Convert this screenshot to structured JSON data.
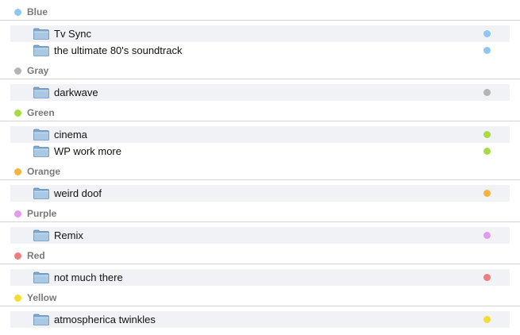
{
  "groups": [
    {
      "label": "Blue",
      "color": "#8ec8f2",
      "items": [
        {
          "label": "Tv Sync",
          "icon": "folder-icon"
        },
        {
          "label": "the ultimate 80's soundtrack",
          "icon": "folder-icon"
        }
      ]
    },
    {
      "label": "Gray",
      "color": "#b4b4b4",
      "items": [
        {
          "label": "darkwave",
          "icon": "folder-icon"
        }
      ]
    },
    {
      "label": "Green",
      "color": "#a6dc3c",
      "items": [
        {
          "label": "cinema",
          "icon": "folder-icon"
        },
        {
          "label": "WP work more",
          "icon": "folder-icon"
        }
      ]
    },
    {
      "label": "Orange",
      "color": "#f6b33c",
      "items": [
        {
          "label": "weird doof",
          "icon": "folder-icon"
        }
      ]
    },
    {
      "label": "Purple",
      "color": "#e39aee",
      "items": [
        {
          "label": "Remix",
          "icon": "folder-icon"
        }
      ]
    },
    {
      "label": "Red",
      "color": "#ef7d7d",
      "items": [
        {
          "label": "not much there",
          "icon": "folder-icon"
        }
      ]
    },
    {
      "label": "Yellow",
      "color": "#f6dc2c",
      "items": [
        {
          "label": "atmospherica twinkles",
          "icon": "folder-icon"
        }
      ]
    }
  ]
}
